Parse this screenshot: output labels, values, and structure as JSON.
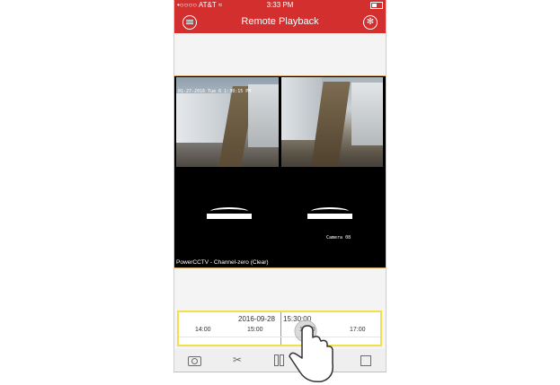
{
  "status_bar": {
    "carrier": "•○○○○ AT&T ≈",
    "time": "3:33 PM"
  },
  "nav": {
    "title": "Remote Playback"
  },
  "video": {
    "osd_text": "01-27-2016 Tue 6 1:30:15 PM",
    "camera_label": "Camera 08",
    "channel_label": "PowerCCTV - Channel-zero (Clear)"
  },
  "timeline": {
    "date": "2016-09-28",
    "time": "15:30:00",
    "ticks": [
      "14:00",
      "15:00",
      "16:00",
      "17:00"
    ]
  },
  "toolbar": {
    "snapshot_icon": "camera-icon",
    "cut_icon": "scissors-icon",
    "pause_icon": "pause-icon",
    "clip_icon": "clip-icon"
  },
  "colors": {
    "accent": "#d32f2f",
    "timeline_border": "#f2e04a"
  }
}
